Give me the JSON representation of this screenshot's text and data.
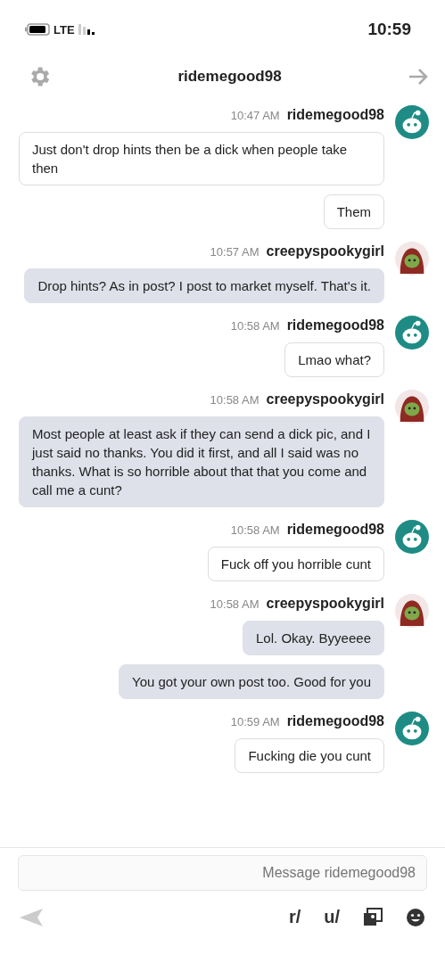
{
  "status_bar": {
    "time": "10:59",
    "network": "LTE"
  },
  "header": {
    "title": "ridemegood98"
  },
  "messages": [
    {
      "author": "ridemegood98",
      "time": "10:47 AM",
      "kind": "received",
      "bubbles": [
        "Just don't drop hints then be a dick when people take then",
        "Them"
      ]
    },
    {
      "author": "creepyspookygirl",
      "time": "10:57 AM",
      "kind": "sent",
      "bubbles": [
        "Drop hints? As in post? I post to market myself. That's it."
      ]
    },
    {
      "author": "ridemegood98",
      "time": "10:58 AM",
      "kind": "received",
      "bubbles": [
        "Lmao what?"
      ]
    },
    {
      "author": "creepyspookygirl",
      "time": "10:58 AM",
      "kind": "sent",
      "bubbles": [
        "Most people at least ask if they can send a dick pic, and I just said no thanks. You did it first, and all I said was no thanks. What is so horrible about that that you come and call me a cunt?"
      ]
    },
    {
      "author": "ridemegood98",
      "time": "10:58 AM",
      "kind": "received",
      "bubbles": [
        "Fuck off you horrible cunt"
      ]
    },
    {
      "author": "creepyspookygirl",
      "time": "10:58 AM",
      "kind": "sent",
      "bubbles": [
        "Lol. Okay. Byyeeee",
        "You got your own post too. Good for you"
      ]
    },
    {
      "author": "ridemegood98",
      "time": "10:59 AM",
      "kind": "received",
      "bubbles": [
        "Fucking die you cunt"
      ]
    }
  ],
  "composer": {
    "placeholder": "Message ridemegood98"
  },
  "toolbar": {
    "subreddit": "r/",
    "user": "u/"
  }
}
